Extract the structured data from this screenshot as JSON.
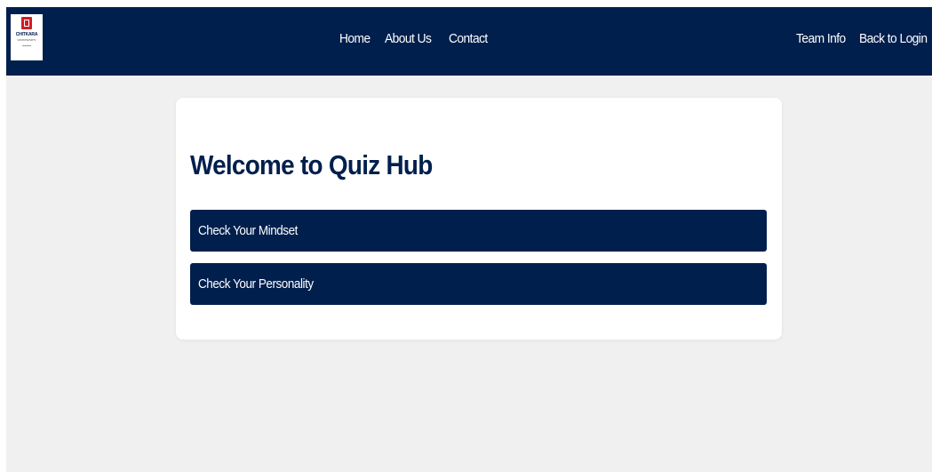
{
  "navbar": {
    "logo": {
      "name": "CHITKARA",
      "sub": "UNIVERSITY"
    },
    "center_links": [
      "Home",
      "About Us",
      "Contact"
    ],
    "right_links": [
      "Team Info",
      "Back to Login"
    ],
    "background": "#001f4d"
  },
  "main": {
    "title": "Welcome to Quiz Hub",
    "buttons": [
      "Check Your Mindset",
      "Check Your Personality"
    ]
  },
  "colors": {
    "primary": "#001f4d",
    "page_background": "#f0f0f0",
    "card_background": "#ffffff",
    "logo_accent": "#d01c27"
  }
}
